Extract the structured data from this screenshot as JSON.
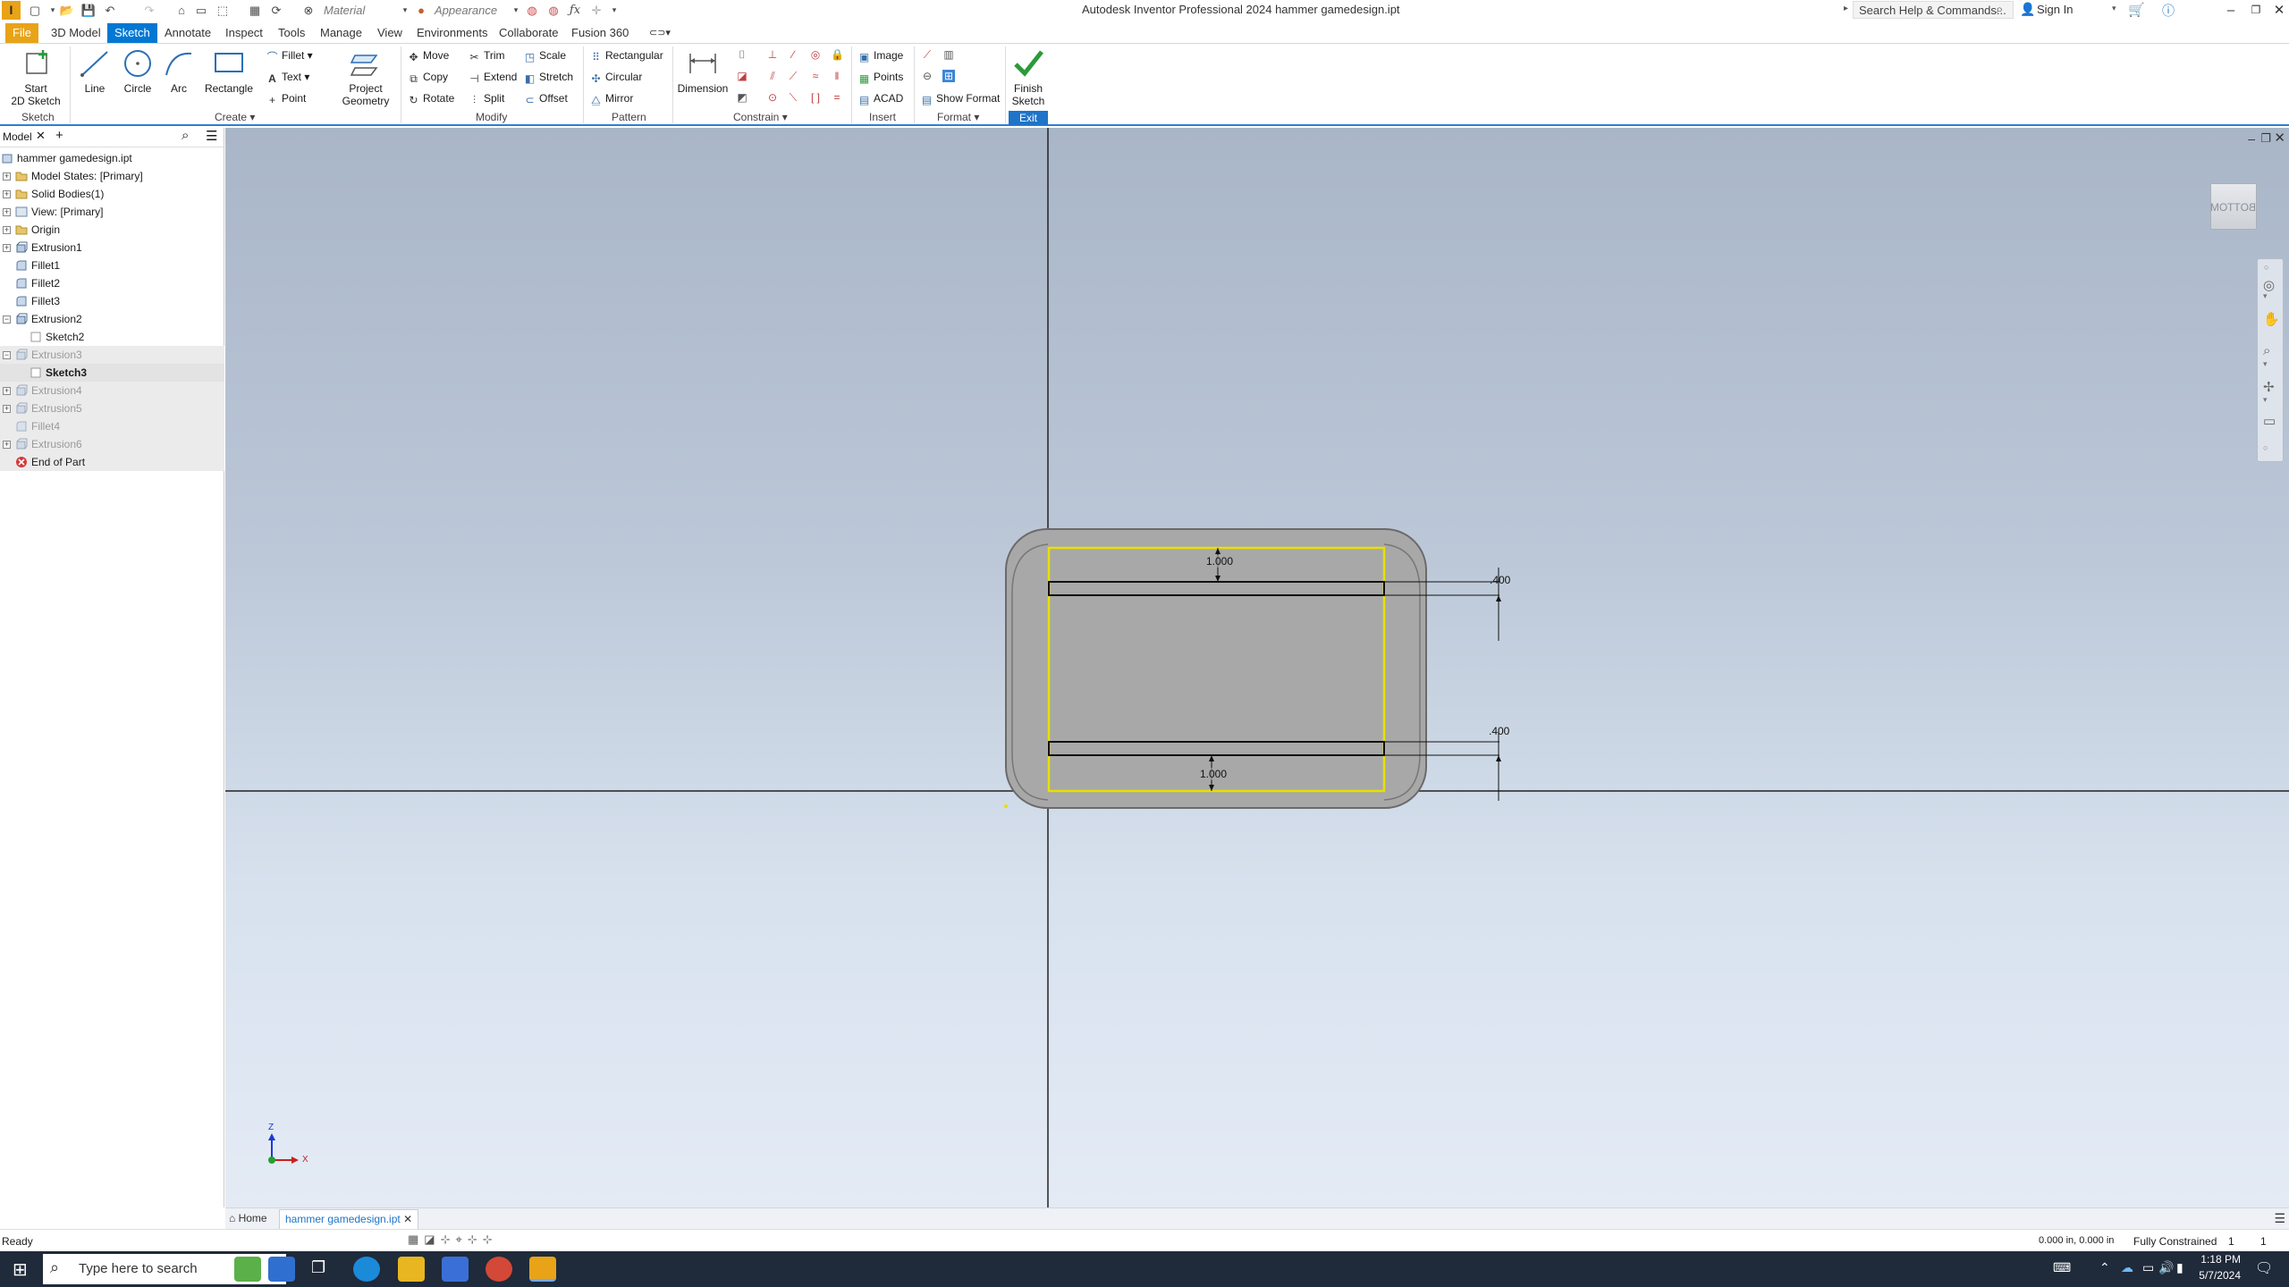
{
  "titlebar": {
    "title": "Autodesk Inventor Professional 2024   hammer gamedesign.ipt",
    "material_combo": "Material",
    "appearance_combo": "Appearance",
    "search_placeholder": "Search Help & Commands...",
    "sign_in": "Sign In"
  },
  "menu_tabs": [
    "File",
    "3D Model",
    "Sketch",
    "Annotate",
    "Inspect",
    "Tools",
    "Manage",
    "View",
    "Environments",
    "Collaborate",
    "Fusion 360"
  ],
  "active_tab": "Sketch",
  "ribbon": {
    "sketch_panel": {
      "start_label1": "Start",
      "start_label2": "2D Sketch",
      "label": "Sketch"
    },
    "create_panel": {
      "line": "Line",
      "circle": "Circle",
      "arc": "Arc",
      "rectangle": "Rectangle",
      "fillet": "Fillet",
      "text": "Text",
      "point": "Point",
      "project1": "Project",
      "project2": "Geometry",
      "label": "Create"
    },
    "modify_panel": {
      "move": "Move",
      "trim": "Trim",
      "scale": "Scale",
      "copy": "Copy",
      "extend": "Extend",
      "stretch": "Stretch",
      "rotate": "Rotate",
      "split": "Split",
      "offset": "Offset",
      "label": "Modify"
    },
    "pattern_panel": {
      "rectangular": "Rectangular",
      "circular": "Circular",
      "mirror": "Mirror",
      "label": "Pattern"
    },
    "constrain_panel": {
      "dimension": "Dimension",
      "label": "Constrain"
    },
    "insert_panel": {
      "image": "Image",
      "points": "Points",
      "acad": "ACAD",
      "label": "Insert"
    },
    "format_panel": {
      "show_format": "Show Format",
      "label": "Format"
    },
    "exit_panel": {
      "finish1": "Finish",
      "finish2": "Sketch",
      "label": "Exit"
    }
  },
  "browser": {
    "tab_model": "Model",
    "items": [
      {
        "label": "hammer gamedesign.ipt",
        "indent": 0
      },
      {
        "label": "Model States: [Primary]",
        "indent": 1
      },
      {
        "label": "Solid Bodies(1)",
        "indent": 1
      },
      {
        "label": "View: [Primary]",
        "indent": 1
      },
      {
        "label": "Origin",
        "indent": 1
      },
      {
        "label": "Extrusion1",
        "indent": 1
      },
      {
        "label": "Fillet1",
        "indent": 1
      },
      {
        "label": "Fillet2",
        "indent": 1
      },
      {
        "label": "Fillet3",
        "indent": 1
      },
      {
        "label": "Extrusion2",
        "indent": 1
      },
      {
        "label": "Sketch2",
        "indent": 2
      },
      {
        "label": "Extrusion3",
        "indent": 1
      },
      {
        "label": "Sketch3",
        "indent": 2
      },
      {
        "label": "Extrusion4",
        "indent": 1
      },
      {
        "label": "Extrusion5",
        "indent": 1
      },
      {
        "label": "Fillet4",
        "indent": 1
      },
      {
        "label": "Extrusion6",
        "indent": 1
      },
      {
        "label": "End of Part",
        "indent": 1
      }
    ]
  },
  "viewport": {
    "viewcube_label": "BOTTOM",
    "dimensions": {
      "top_height": "1.000",
      "bottom_height": "1.000",
      "top_offset": ".400",
      "bottom_offset": ".400"
    },
    "triad": {
      "z": "Z",
      "x": "X"
    }
  },
  "doc_tabs": {
    "home": "Home",
    "active": "hammer gamedesign.ipt"
  },
  "statusbar": {
    "left": "Ready",
    "coords": "0.000 in, 0.000 in",
    "constraint": "Fully Constrained",
    "count1": "1",
    "count2": "1"
  },
  "taskbar": {
    "search_placeholder": "Type here to search",
    "time": "1:18 PM",
    "date": "5/7/2024"
  }
}
